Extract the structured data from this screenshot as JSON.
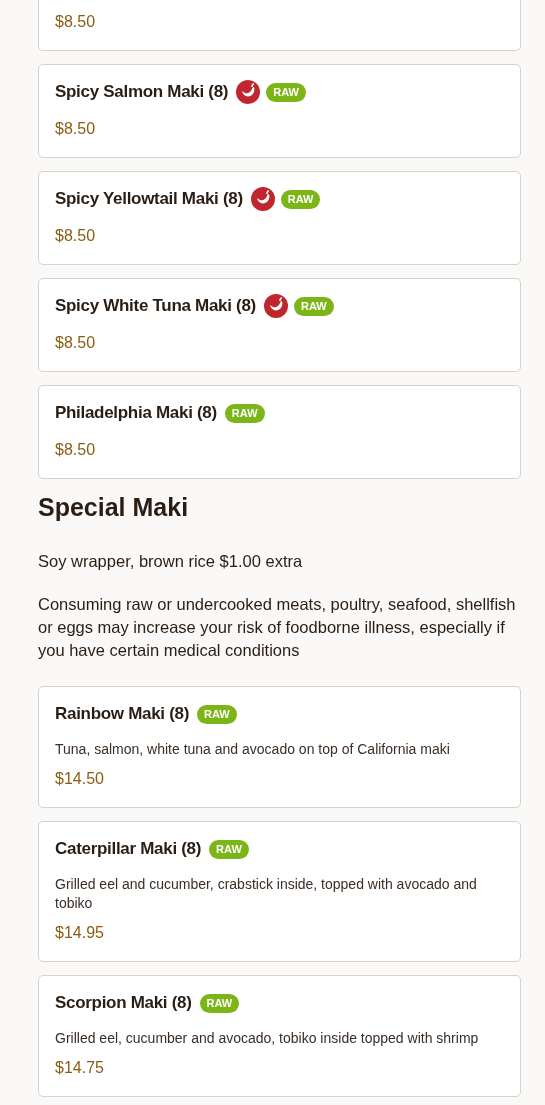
{
  "sections": [
    {
      "items": [
        {
          "price": "$8.50"
        },
        {
          "name": "Spicy Salmon Maki (8)",
          "price": "$8.50",
          "badges": [
            {
              "kind": "spicy"
            },
            {
              "kind": "raw",
              "label": "RAW"
            }
          ]
        },
        {
          "name": "Spicy Yellowtail Maki (8)",
          "price": "$8.50",
          "badges": [
            {
              "kind": "spicy"
            },
            {
              "kind": "raw",
              "label": "RAW"
            }
          ]
        },
        {
          "name": "Spicy White Tuna Maki (8)",
          "price": "$8.50",
          "badges": [
            {
              "kind": "spicy"
            },
            {
              "kind": "raw",
              "label": "RAW"
            }
          ]
        },
        {
          "name": "Philadelphia Maki (8)",
          "price": "$8.50",
          "badges": [
            {
              "kind": "raw",
              "label": "RAW"
            }
          ]
        }
      ]
    },
    {
      "title": "Special Maki",
      "notes": [
        "Soy wrapper, brown rice $1.00 extra",
        "Consuming raw or undercooked meats, poultry, seafood, shellfish or eggs may increase your risk of foodborne illness, especially if you have certain medical conditions"
      ],
      "items": [
        {
          "name": "Rainbow Maki (8)",
          "description": "Tuna, salmon, white tuna and avocado on top of California maki",
          "price": "$14.50",
          "badges": [
            {
              "kind": "raw",
              "label": "RAW"
            }
          ]
        },
        {
          "name": "Caterpillar Maki (8)",
          "description": "Grilled eel and cucumber, crabstick inside, topped with avocado and tobiko",
          "price": "$14.95",
          "badges": [
            {
              "kind": "raw",
              "label": "RAW"
            }
          ]
        },
        {
          "name": "Scorpion Maki (8)",
          "description": "Grilled eel, cucumber and avocado, tobiko inside topped with shrimp",
          "price": "$14.75",
          "badges": [
            {
              "kind": "raw",
              "label": "RAW"
            }
          ]
        }
      ]
    }
  ]
}
